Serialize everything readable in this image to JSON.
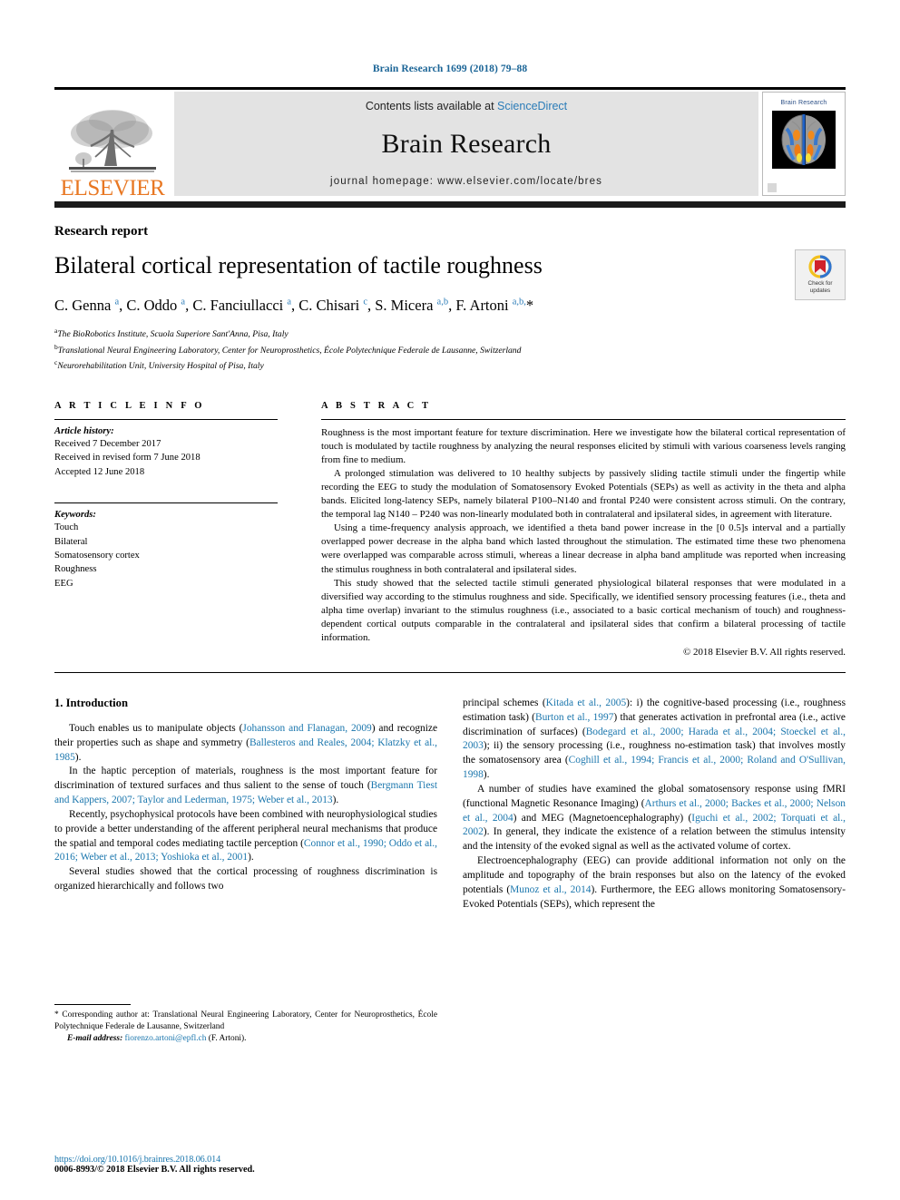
{
  "running_head": "Brain Research 1699 (2018) 79–88",
  "masthead": {
    "contents_prefix": "Contents lists available at ",
    "sciencedirect": "ScienceDirect",
    "journal_name": "Brain Research",
    "homepage": "journal homepage: www.elsevier.com/locate/bres",
    "publisher_wordmark": "ELSEVIER",
    "cover_title": "Brain Research",
    "accent_orange": "#E87722",
    "link_blue": "#1a76ad",
    "header_blue": "#1a6496"
  },
  "article": {
    "type": "Research report",
    "title": "Bilateral cortical representation of tactile roughness",
    "authors_html": "C. Genna <sup>a</sup>, C. Oddo <sup>a</sup>, C. Fanciullacci <sup>a</sup>, C. Chisari <sup>c</sup>, S. Micera <sup>a,b</sup>, F. Artoni <sup>a,b,</sup>*",
    "affiliations": [
      "The BioRobotics Institute, Scuola Superiore Sant'Anna, Pisa, Italy",
      "Translational Neural Engineering Laboratory, Center for Neuroprosthetics, École Polytechnique Federale de Lausanne, Switzerland",
      "Neurorehabilitation Unit, University Hospital of Pisa, Italy"
    ],
    "affiliation_marks": [
      "a",
      "b",
      "c"
    ]
  },
  "crossmark": {
    "line1": "Check for",
    "line2": "updates"
  },
  "article_info": {
    "heading": "A R T I C L E   I N F O",
    "history_label": "Article history:",
    "history": [
      "Received 7 December 2017",
      "Received in revised form 7 June 2018",
      "Accepted 12 June 2018"
    ],
    "keywords_label": "Keywords:",
    "keywords": [
      "Touch",
      "Bilateral",
      "Somatosensory cortex",
      "Roughness",
      "EEG"
    ]
  },
  "abstract": {
    "heading": "A B S T R A C T",
    "paragraphs": [
      "Roughness is the most important feature for texture discrimination. Here we investigate how the bilateral cortical representation of touch is modulated by tactile roughness by analyzing the neural responses elicited by stimuli with various coarseness levels ranging from fine to medium.",
      "A prolonged stimulation was delivered to 10 healthy subjects by passively sliding tactile stimuli under the fingertip while recording the EEG to study the modulation of Somatosensory Evoked Potentials (SEPs) as well as activity in the theta and alpha bands. Elicited long-latency SEPs, namely bilateral P100–N140 and frontal P240 were consistent across stimuli. On the contrary, the temporal lag N140 – P240 was non-linearly modulated both in contralateral and ipsilateral sides, in agreement with literature.",
      "Using a time-frequency analysis approach, we identified a theta band power increase in the [0 0.5]s interval and a partially overlapped power decrease in the alpha band which lasted throughout the stimulation. The estimated time these two phenomena were overlapped was comparable across stimuli, whereas a linear decrease in alpha band amplitude was reported when increasing the stimulus roughness in both contralateral and ipsilateral sides.",
      "This study showed that the selected tactile stimuli generated physiological bilateral responses that were modulated in a diversified way according to the stimulus roughness and side. Specifically, we identified sensory processing features (i.e., theta and alpha time overlap) invariant to the stimulus roughness (i.e., associated to a basic cortical mechanism of touch) and roughness-dependent cortical outputs comparable in the contralateral and ipsilateral sides that confirm a bilateral processing of tactile information."
    ],
    "copyright": "© 2018 Elsevier B.V. All rights reserved."
  },
  "introduction": {
    "heading": "1. Introduction",
    "left_paragraphs": [
      {
        "segments": [
          {
            "t": "Touch enables us to manipulate objects (",
            "c": false
          },
          {
            "t": "Johansson and Flanagan, 2009",
            "c": true
          },
          {
            "t": ") and recognize their properties such as shape and symmetry (",
            "c": false
          },
          {
            "t": "Ballesteros and Reales, 2004; Klatzky et al., 1985",
            "c": true
          },
          {
            "t": ").",
            "c": false
          }
        ]
      },
      {
        "segments": [
          {
            "t": "In the haptic perception of materials, roughness is the most important feature for discrimination of textured surfaces and thus salient to the sense of touch (",
            "c": false
          },
          {
            "t": "Bergmann Tiest and Kappers, 2007; Taylor and Lederman, 1975; Weber et al., 2013",
            "c": true
          },
          {
            "t": ").",
            "c": false
          }
        ]
      },
      {
        "segments": [
          {
            "t": "Recently, psychophysical protocols have been combined with neurophysiological studies to provide a better understanding of the afferent peripheral neural mechanisms that produce the spatial and temporal codes mediating tactile perception (",
            "c": false
          },
          {
            "t": "Connor et al., 1990; Oddo et al., 2016; Weber et al., 2013; Yoshioka et al., 2001",
            "c": true
          },
          {
            "t": ").",
            "c": false
          }
        ]
      },
      {
        "segments": [
          {
            "t": "Several studies showed that the cortical processing of roughness discrimination is organized hierarchically and follows two",
            "c": false
          }
        ]
      }
    ],
    "right_paragraphs": [
      {
        "segments": [
          {
            "t": "principal schemes (",
            "c": false
          },
          {
            "t": "Kitada et al., 2005",
            "c": true
          },
          {
            "t": "): i) the cognitive-based processing (i.e., roughness estimation task) (",
            "c": false
          },
          {
            "t": "Burton et al., 1997",
            "c": true
          },
          {
            "t": ") that generates activation in prefrontal area (i.e., active discrimination of surfaces) (",
            "c": false
          },
          {
            "t": "Bodegard et al., 2000; Harada et al., 2004; Stoeckel et al., 2003",
            "c": true
          },
          {
            "t": "); ii) the sensory processing (i.e., roughness no-estimation task) that involves mostly the somatosensory area (",
            "c": false
          },
          {
            "t": "Coghill et al., 1994; Francis et al., 2000; Roland and O'Sullivan, 1998",
            "c": true
          },
          {
            "t": ").",
            "c": false
          }
        ],
        "no_indent": true
      },
      {
        "segments": [
          {
            "t": "A number of studies have examined the global somatosensory response using fMRI (functional Magnetic Resonance Imaging) (",
            "c": false
          },
          {
            "t": "Arthurs et al., 2000; Backes et al., 2000; Nelson et al., 2004",
            "c": true
          },
          {
            "t": ") and MEG (Magnetoencephalography) (",
            "c": false
          },
          {
            "t": "Iguchi et al., 2002; Torquati et al., 2002",
            "c": true
          },
          {
            "t": "). In general, they indicate the existence of a relation between the stimulus intensity and the intensity of the evoked signal as well as the activated volume of cortex.",
            "c": false
          }
        ]
      },
      {
        "segments": [
          {
            "t": "Electroencephalography (EEG) can provide additional information not only on the amplitude and topography of the brain responses but also on the latency of the evoked potentials (",
            "c": false
          },
          {
            "t": "Munoz et al., 2014",
            "c": true
          },
          {
            "t": "). Furthermore, the EEG allows monitoring Somatosensory-Evoked Potentials (SEPs), which represent the",
            "c": false
          }
        ]
      }
    ]
  },
  "footnote": {
    "star": "*",
    "corresponding": "Corresponding author at: Translational Neural Engineering Laboratory, Center for Neuroprosthetics, École Polytechnique Federale de Lausanne, Switzerland",
    "email_label": "E-mail address:",
    "email": "fiorenzo.artoni@epfl.ch",
    "email_suffix": "(F. Artoni)."
  },
  "page_footer": {
    "doi": "https://doi.org/10.1016/j.brainres.2018.06.014",
    "issn_line": "0006-8993/© 2018 Elsevier B.V. All rights reserved."
  }
}
